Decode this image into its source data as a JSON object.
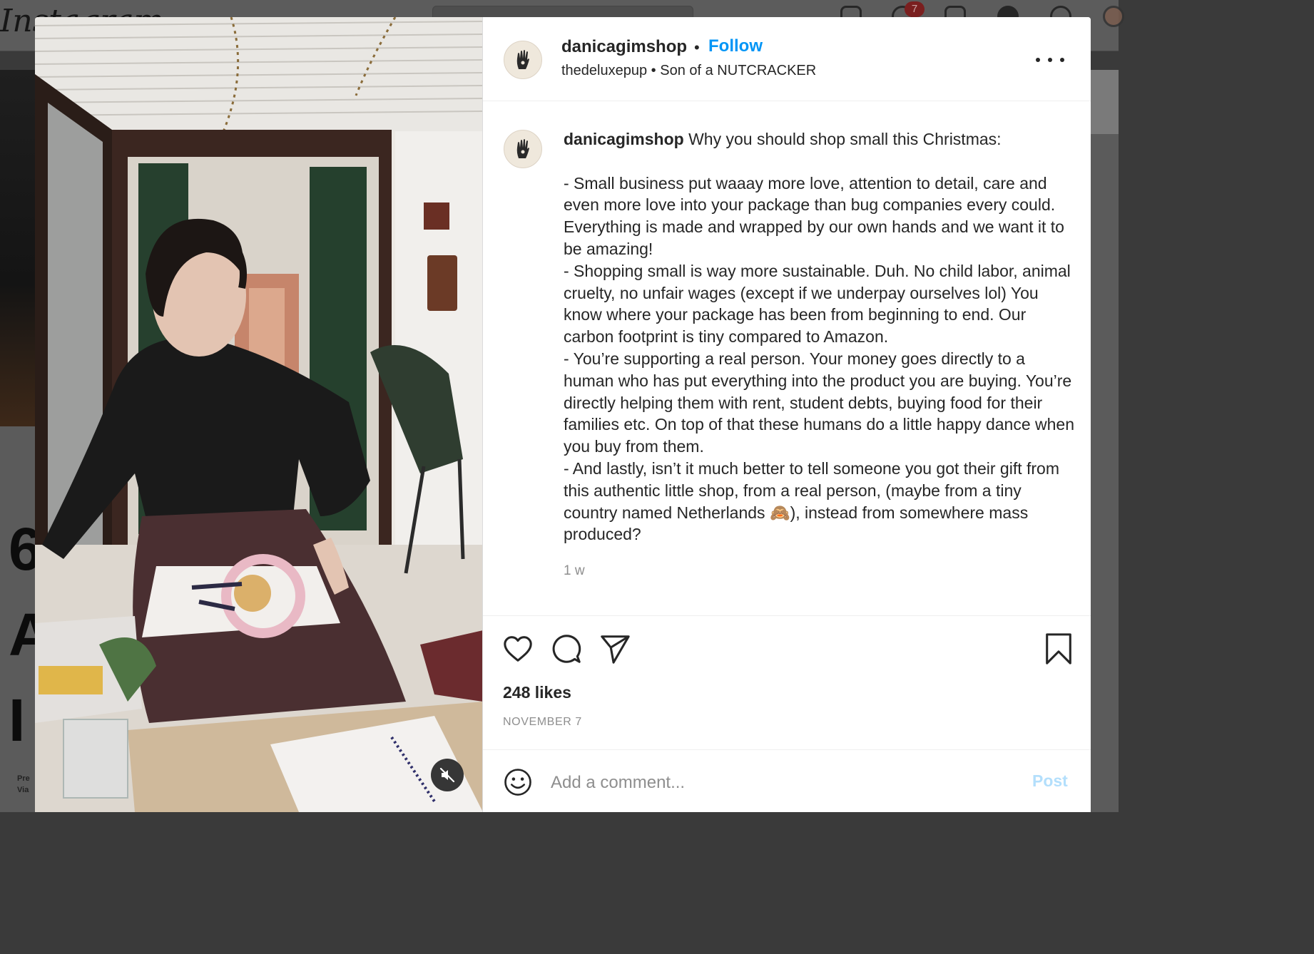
{
  "background": {
    "logo_text": "Instagram",
    "notification_count": "7",
    "article_letters": [
      "6",
      "A",
      "I"
    ],
    "article_small": [
      "Pre",
      "Via"
    ]
  },
  "post": {
    "header": {
      "username": "danicagimshop",
      "separator": "•",
      "follow_label": "Follow",
      "audio_user": "thedeluxepup",
      "audio_separator": "•",
      "audio_title": "Son of a NUTCRACKER"
    },
    "caption": {
      "username": "danicagimshop",
      "text": " Why you should shop small this Christmas:\n\n- Small business put waaay more love, attention to detail, care and even more love into your package than bug companies every could. Everything is made and wrapped by our own hands and we want it to be amazing!\n- Shopping small is way more sustainable. Duh. No child labor, animal cruelty, no unfair wages (except if we underpay ourselves lol) You know where your package has been from beginning to end. Our carbon footprint is tiny compared to Amazon.\n- You’re supporting a real person. Your money goes directly to a human who has put everything into the product you are buying. You’re directly helping them with rent, student debts, buying food for their families etc. On top of that these humans do a little happy dance when you buy from them.\n- And lastly, isn’t it much better to tell someone you got their gift from this authentic little shop, from a real person, (maybe from a tiny country named Netherlands 🙈), instead from somewhere mass produced?",
      "time_ago": "1 w"
    },
    "likes": "248 likes",
    "date": "NOVEMBER 7",
    "comment_placeholder": "Add a comment...",
    "post_label": "Post",
    "icons": {
      "like": "heart-icon",
      "comment": "speech-bubble-icon",
      "share": "paper-plane-icon",
      "save": "bookmark-icon",
      "more": "ellipsis-icon",
      "emoji": "smiley-icon",
      "mute": "speaker-muted-icon"
    },
    "colors": {
      "link_blue": "#0095f6",
      "post_disabled": "#b3dffc",
      "text": "#262626",
      "muted": "#8e8e8e"
    }
  }
}
